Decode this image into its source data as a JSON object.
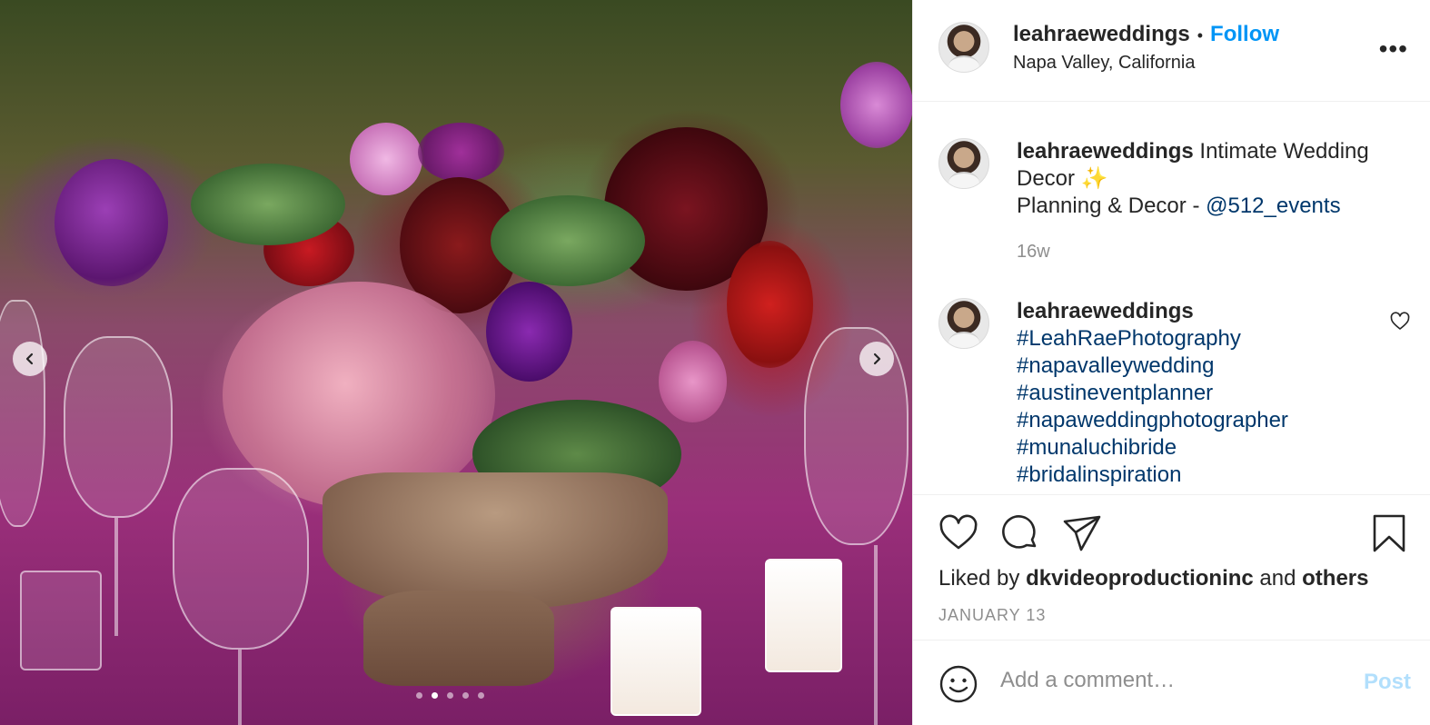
{
  "photo": {
    "alt_subject": "floral centerpiece",
    "carousel": {
      "total": 5,
      "active_index": 1
    }
  },
  "header": {
    "username": "leahraeweddings",
    "separator": "•",
    "follow_label": "Follow",
    "location": "Napa Valley, California",
    "more_icon": "more-options-icon"
  },
  "caption": {
    "username": "leahraeweddings",
    "text_line1": "Intimate Wedding",
    "text_line2": "Decor ✨",
    "planning_prefix": "Planning & Decor - ",
    "planning_mention": "@512_events",
    "time": "16w"
  },
  "comment": {
    "username": "leahraeweddings",
    "hashtags": [
      "#LeahRaePhotography",
      "#napavalleywedding",
      "#austineventplanner",
      "#napaweddingphotographer",
      "#munaluchibride",
      "#bridalinspiration"
    ]
  },
  "actions": {
    "liked_prefix": "Liked by ",
    "liked_user": "dkvideoproductioninc",
    "liked_and": " and ",
    "liked_others": "others",
    "date": "JANUARY 13"
  },
  "comment_bar": {
    "placeholder": "Add a comment…",
    "post_label": "Post"
  },
  "colors": {
    "link_blue": "#0095f6",
    "mention_blue": "#00376b",
    "muted": "#8e8e8e",
    "post_disabled": "#b2dffc"
  }
}
